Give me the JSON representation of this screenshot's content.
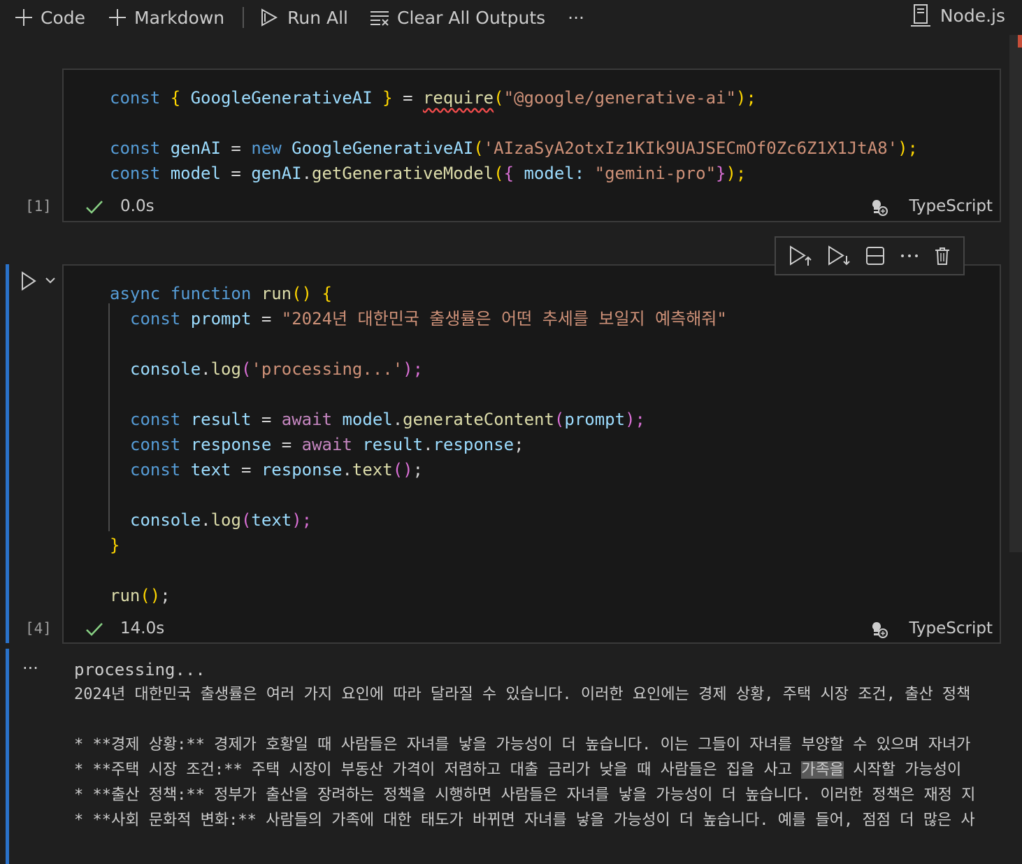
{
  "toolbar": {
    "code_label": "Code",
    "markdown_label": "Markdown",
    "run_all_label": "Run All",
    "clear_outputs_label": "Clear All Outputs",
    "more_label": "···",
    "kernel_label": "Node.js"
  },
  "cell1": {
    "lines": [
      {
        "t1": "const",
        "t2": "{",
        "t3": "GoogleGenerativeAI",
        "t4": "}",
        "t5": "=",
        "t6": "require",
        "t7": "(",
        "t8": "\"@google/generative-ai\"",
        "t9": ");"
      },
      {
        "t1": "const",
        "t2": "genAI",
        "t3": "=",
        "t4": "new",
        "t5": "GoogleGenerativeAI",
        "t6": "(",
        "t7": "'AIzaSyA2otxIz1KIk9UAJSECmOf0Zc6Z1X1JtA8'",
        "t8": ");"
      },
      {
        "t1": "const",
        "t2": "model",
        "t3": "=",
        "t4": "genAI",
        "t5": ".",
        "t6": "getGenerativeModel",
        "t7": "(",
        "t8": "{",
        "t9": "model",
        "t10": ":",
        "t11": "\"gemini-pro\"",
        "t12": "}",
        "t13": ");"
      }
    ],
    "exec_count": "[1]",
    "time": "0.0s",
    "language": "TypeScript"
  },
  "cell2": {
    "l1": {
      "a": "async",
      "b": "function",
      "c": "run",
      "d": "()",
      "e": "{"
    },
    "l2": {
      "a": "const",
      "b": "prompt",
      "c": "=",
      "d": "\"2024년 대한민국 출생률은 어떤 추세를 보일지 예측해줘\""
    },
    "l3": {
      "a": "console",
      "b": ".",
      "c": "log",
      "d": "(",
      "e": "'processing...'",
      "f": ");"
    },
    "l4": {
      "a": "const",
      "b": "result",
      "c": "=",
      "d": "await",
      "e": "model",
      "f": ".",
      "g": "generateContent",
      "h": "(",
      "i": "prompt",
      "j": ");"
    },
    "l5": {
      "a": "const",
      "b": "response",
      "c": "=",
      "d": "await",
      "e": "result",
      "f": ".",
      "g": "response",
      "h": ";"
    },
    "l6": {
      "a": "const",
      "b": "text",
      "c": "=",
      "d": "response",
      "e": ".",
      "f": "text",
      "g": "()",
      "h": ";"
    },
    "l7": {
      "a": "console",
      "b": ".",
      "c": "log",
      "d": "(",
      "e": "text",
      "f": ");"
    },
    "l8": {
      "a": "}"
    },
    "l9": {
      "a": "run",
      "b": "()",
      "c": ";"
    },
    "exec_count": "[4]",
    "time": "14.0s",
    "language": "TypeScript"
  },
  "output": {
    "more_label": "···",
    "line1": "processing...",
    "line2": "2024년 대한민국 출생률은 여러 가지 요인에 따라 달라질 수 있습니다. 이러한 요인에는 경제 상황, 주택 시장 조건, 출산 정책",
    "line3": "",
    "line4": "* **경제 상황:** 경제가 호황일 때 사람들은 자녀를 낳을 가능성이 더 높습니다. 이는 그들이 자녀를 부양할 수 있으며 자녀가",
    "line5a": "* **주택 시장 조건:** 주택 시장이 부동산 가격이 저렴하고 대출 금리가 낮을 때 사람들은 집을 사고 ",
    "line5hl": "가족을",
    "line5b": " 시작할 가능성이",
    "line6": "* **출산 정책:** 정부가 출산을 장려하는 정책을 시행하면 사람들은 자녀를 낳을 가능성이 더 높습니다. 이러한 정책은 재정 지",
    "line7": "* **사회 문화적 변화:** 사람들의 가족에 대한 태도가 바뀌면 자녀를 낳을 가능성이 더 높습니다. 예를 들어, 점점 더 많은 사"
  }
}
